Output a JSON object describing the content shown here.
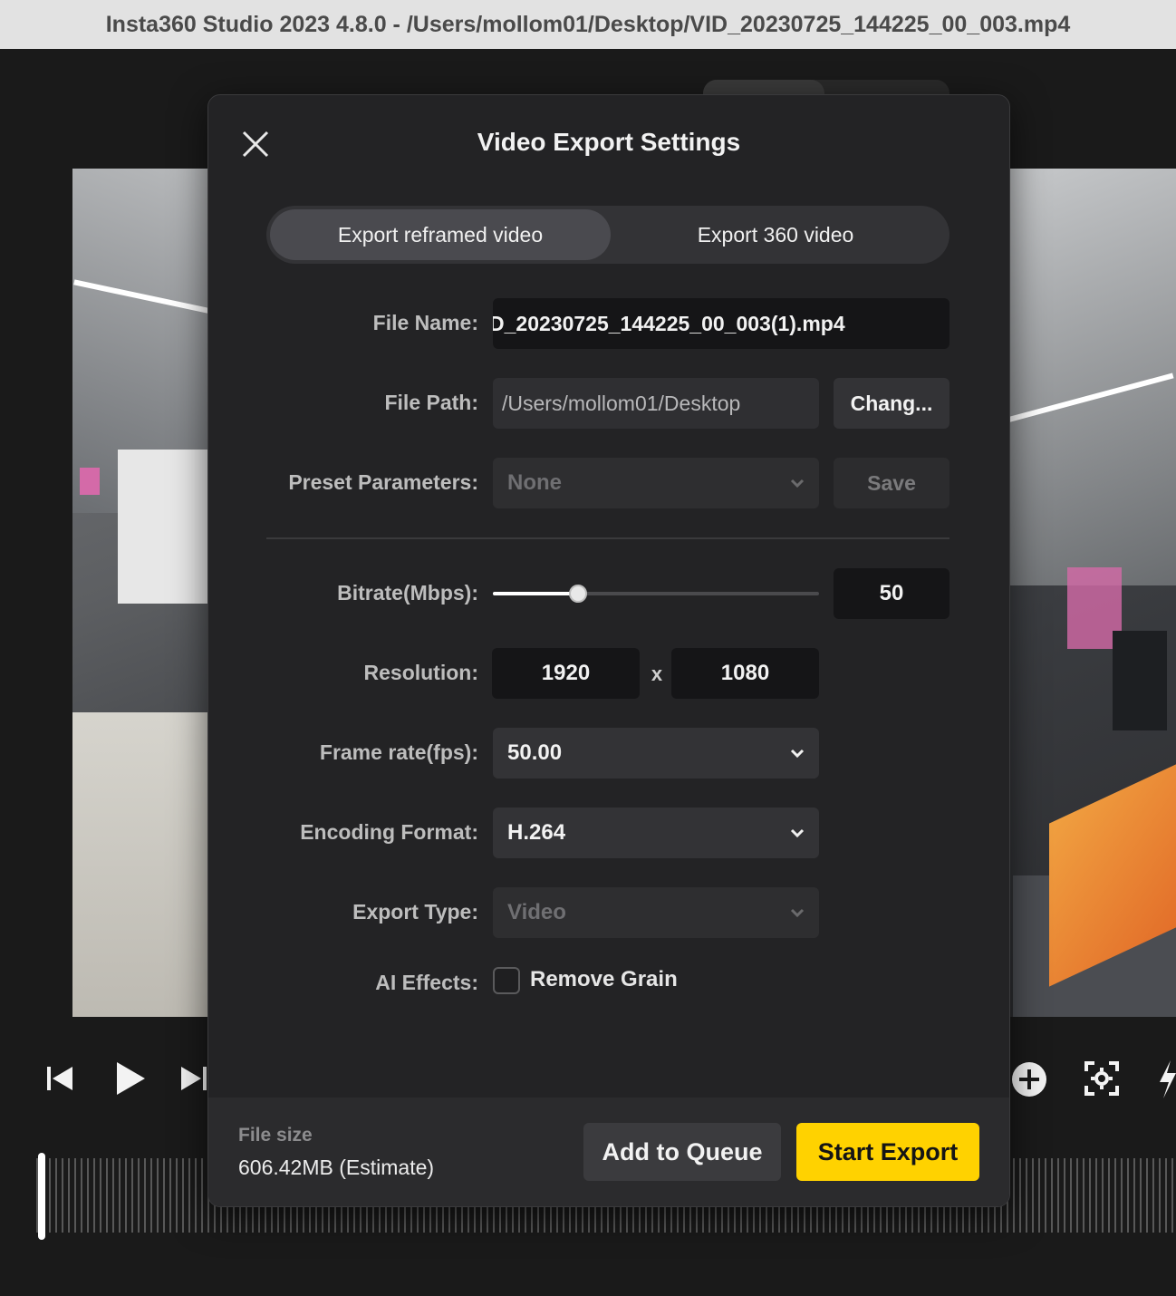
{
  "window": {
    "title": "Insta360 Studio 2023 4.8.0 - /Users/mollom01/Desktop/VID_20230725_144225_00_003.mp4"
  },
  "dialog": {
    "title": "Video Export Settings",
    "tabs": [
      {
        "label": "Export reframed video",
        "active": true
      },
      {
        "label": "Export 360 video",
        "active": false
      }
    ],
    "file_name": {
      "label": "File Name:",
      "value": "D_20230725_144225_00_003(1).mp4"
    },
    "file_path": {
      "label": "File Path:",
      "value": "/Users/mollom01/Desktop",
      "button": "Chang..."
    },
    "preset": {
      "label": "Preset Parameters:",
      "value": "None",
      "button": "Save"
    },
    "bitrate": {
      "label": "Bitrate(Mbps):",
      "value": "50",
      "level": 0.26
    },
    "resolution": {
      "label": "Resolution:",
      "width": "1920",
      "separator": "x",
      "height": "1080"
    },
    "frame_rate": {
      "label": "Frame rate(fps):",
      "value": "50.00"
    },
    "encoding": {
      "label": "Encoding Format:",
      "value": "H.264"
    },
    "export_type": {
      "label": "Export Type:",
      "value": "Video"
    },
    "ai_effects": {
      "label": "AI Effects:",
      "option": "Remove Grain",
      "checked": false
    },
    "footer": {
      "file_size_label": "File size",
      "file_size_value": "606.42MB (Estimate)",
      "queue_button": "Add to Queue",
      "export_button": "Start Export"
    }
  },
  "colors": {
    "accent": "#ffd200",
    "dialog_bg": "#232325"
  },
  "icons": {
    "close": "close-icon",
    "chevron": "chevron-down-icon",
    "prev": "skip-back-icon",
    "play": "play-icon",
    "next": "skip-forward-icon",
    "add": "add-circle-icon",
    "focus": "focus-target-icon",
    "flash": "lightning-icon"
  }
}
